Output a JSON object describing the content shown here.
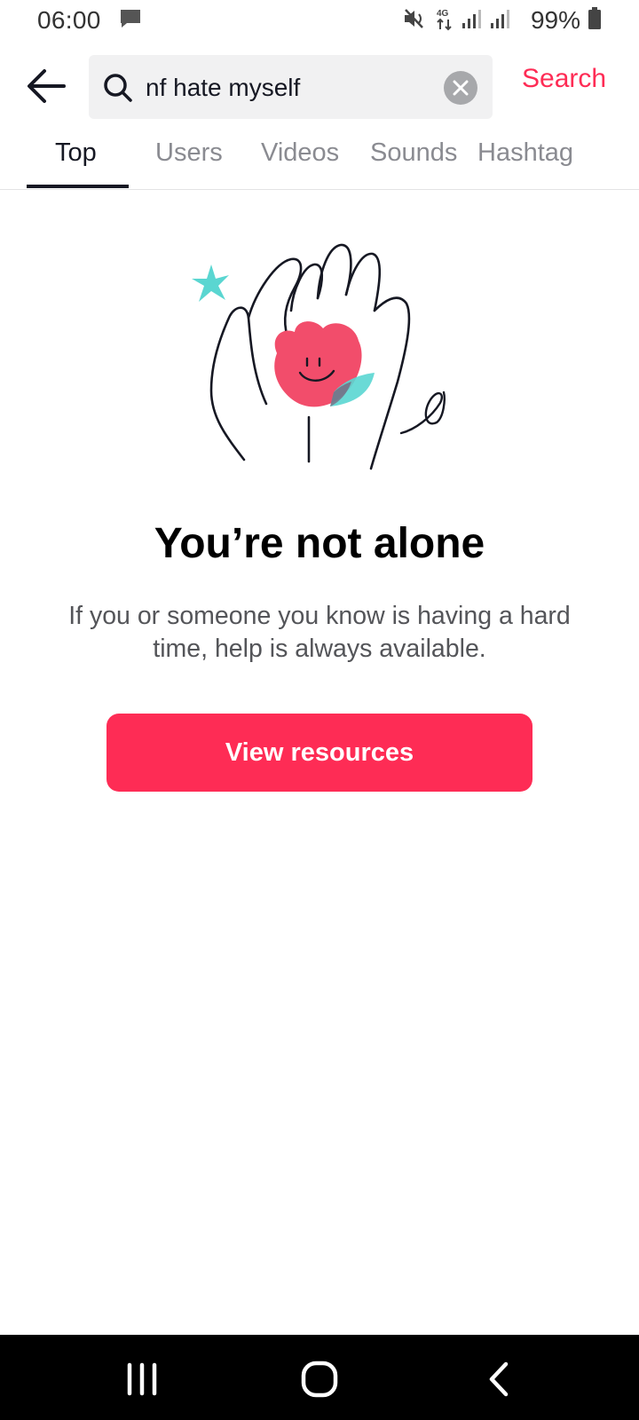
{
  "status_bar": {
    "time": "06:00",
    "battery": "99%",
    "icons": [
      "message-icon",
      "mute-icon",
      "4g-icon",
      "signal-icon",
      "signal-icon",
      "battery-icon"
    ]
  },
  "search": {
    "query": "nf hate myself",
    "submit_label": "Search",
    "icons": [
      "back-arrow-icon",
      "search-icon",
      "clear-icon"
    ]
  },
  "tabs": [
    {
      "label": "Top",
      "active": true
    },
    {
      "label": "Users",
      "active": false
    },
    {
      "label": "Videos",
      "active": false
    },
    {
      "label": "Sounds",
      "active": false
    },
    {
      "label": "Hashtag",
      "active": false
    }
  ],
  "content": {
    "headline": "You’re not alone",
    "message": "If you or someone you know is having a hard time, help is always available.",
    "button_label": "View resources"
  },
  "nav_bar": {
    "icons": [
      "recent-apps-icon",
      "home-icon",
      "back-icon"
    ]
  },
  "colors": {
    "accent": "#fe2c55",
    "tab_inactive": "#8a8b91",
    "illustration_teal": "#5ad6d1"
  }
}
